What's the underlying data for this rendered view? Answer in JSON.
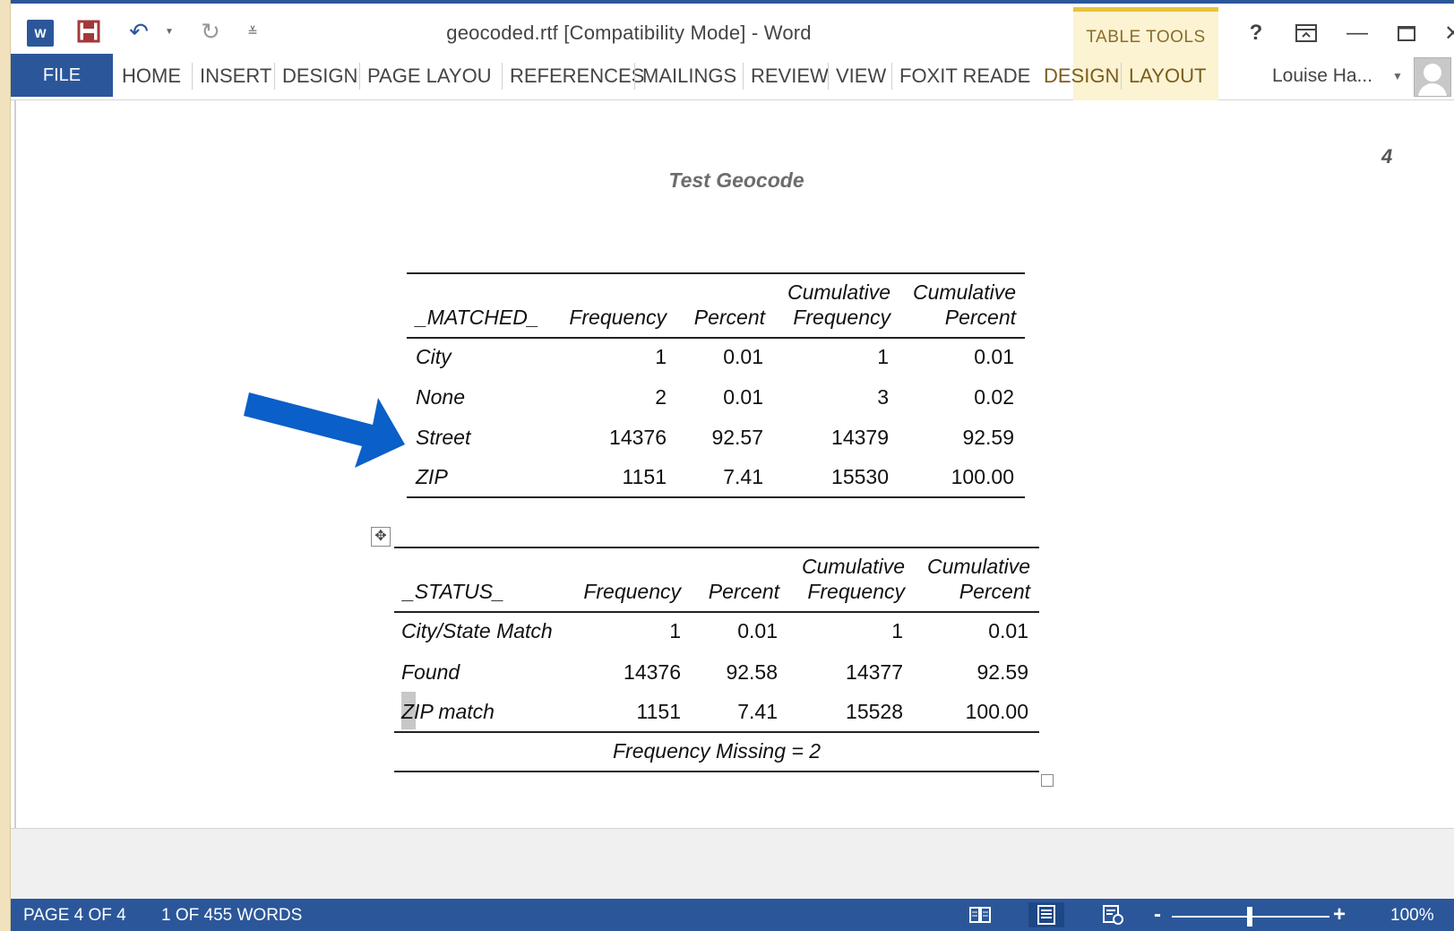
{
  "window": {
    "doc_title": "geocoded.rtf [Compatibility Mode] - Word",
    "context_group_label": "TABLE TOOLS",
    "help_glyph": "?",
    "user_name": "Louise Ha..."
  },
  "tabs": {
    "file": "FILE",
    "home": "HOME",
    "insert": "INSERT",
    "design": "DESIGN",
    "page_layout": "PAGE LAYOU",
    "references": "REFERENCES",
    "mailings": "MAILINGS",
    "review": "REVIEW",
    "view": "VIEW",
    "foxit": "FOXIT READE",
    "table_design": "DESIGN",
    "table_layout": "LAYOUT"
  },
  "document": {
    "page_number": "4",
    "heading": "Test Geocode",
    "matched_table": {
      "headers": {
        "col1": "_MATCHED_",
        "col2": "Frequency",
        "col3": "Percent",
        "col4_line1": "Cumulative",
        "col4_line2": "Frequency",
        "col5_line1": "Cumulative",
        "col5_line2": "Percent"
      },
      "rows": [
        {
          "label": "City",
          "frequency": "1",
          "percent": "0.01",
          "cum_frequency": "1",
          "cum_percent": "0.01"
        },
        {
          "label": "None",
          "frequency": "2",
          "percent": "0.01",
          "cum_frequency": "3",
          "cum_percent": "0.02"
        },
        {
          "label": "Street",
          "frequency": "14376",
          "percent": "92.57",
          "cum_frequency": "14379",
          "cum_percent": "92.59"
        },
        {
          "label": "ZIP",
          "frequency": "1151",
          "percent": "7.41",
          "cum_frequency": "15530",
          "cum_percent": "100.00"
        }
      ]
    },
    "status_table": {
      "headers": {
        "col1": "_STATUS_",
        "col2": "Frequency",
        "col3": "Percent",
        "col4_line1": "Cumulative",
        "col4_line2": "Frequency",
        "col5_line1": "Cumulative",
        "col5_line2": "Percent"
      },
      "rows": [
        {
          "label": "City/State Match",
          "frequency": "1",
          "percent": "0.01",
          "cum_frequency": "1",
          "cum_percent": "0.01"
        },
        {
          "label": "Found",
          "frequency": "14376",
          "percent": "92.58",
          "cum_frequency": "14377",
          "cum_percent": "92.59"
        },
        {
          "label": "ZIP match",
          "frequency": "1151",
          "percent": "7.41",
          "cum_frequency": "15528",
          "cum_percent": "100.00"
        }
      ],
      "footer": "Frequency Missing = 2"
    },
    "arrow_color": "#0a5fc8"
  },
  "status_bar": {
    "page_info": "PAGE 4 OF 4",
    "word_count": "1 OF 455 WORDS",
    "zoom_level": "100%",
    "zoom_minus": "-",
    "zoom_plus": "+"
  },
  "colors": {
    "accent": "#2b579a",
    "context_tab_bg": "#fbf3d2",
    "context_tab_accent": "#e8c33c"
  }
}
